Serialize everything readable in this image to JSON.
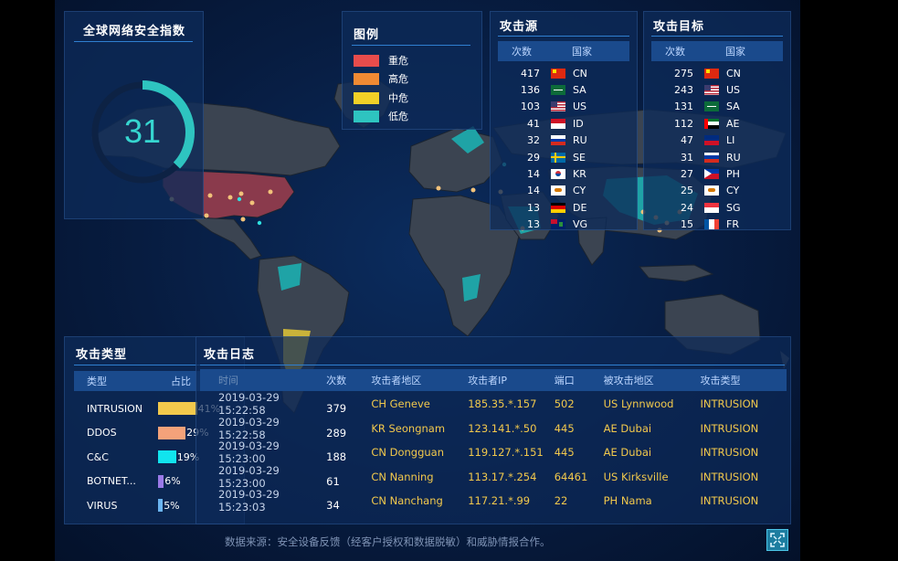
{
  "index_panel": {
    "title": "全球网络安全指数",
    "value": "31",
    "level": 0.31
  },
  "legend": {
    "title": "图例",
    "items": [
      {
        "label": "重危",
        "color": "#e84c4c"
      },
      {
        "label": "高危",
        "color": "#f08a33"
      },
      {
        "label": "中危",
        "color": "#f2d027"
      },
      {
        "label": "低危",
        "color": "#2ec4c0"
      }
    ]
  },
  "attack_source": {
    "title": "攻击源",
    "headers": {
      "count": "次数",
      "country": "国家"
    },
    "rows": [
      {
        "count": "417",
        "code": "CN",
        "flag": "cn-flag"
      },
      {
        "count": "136",
        "code": "SA",
        "flag": "sa-flag"
      },
      {
        "count": "103",
        "code": "US",
        "flag": "us-flag"
      },
      {
        "count": "41",
        "code": "ID",
        "flag": "id-flag"
      },
      {
        "count": "32",
        "code": "RU",
        "flag": "ru-flag"
      },
      {
        "count": "29",
        "code": "SE",
        "flag": "se-flag"
      },
      {
        "count": "14",
        "code": "KR",
        "flag": "kr-flag"
      },
      {
        "count": "14",
        "code": "CY",
        "flag": "cy-flag"
      },
      {
        "count": "13",
        "code": "DE",
        "flag": "de-flag"
      },
      {
        "count": "13",
        "code": "VG",
        "flag": "vg-flag"
      }
    ]
  },
  "attack_target": {
    "title": "攻击目标",
    "headers": {
      "count": "次数",
      "country": "国家"
    },
    "rows": [
      {
        "count": "275",
        "code": "CN",
        "flag": "cn-flag"
      },
      {
        "count": "243",
        "code": "US",
        "flag": "us-flag"
      },
      {
        "count": "131",
        "code": "SA",
        "flag": "sa-flag"
      },
      {
        "count": "112",
        "code": "AE",
        "flag": "ae-flag"
      },
      {
        "count": "47",
        "code": "LI",
        "flag": "li-flag"
      },
      {
        "count": "31",
        "code": "RU",
        "flag": "ru-flag"
      },
      {
        "count": "27",
        "code": "PH",
        "flag": "ph-flag"
      },
      {
        "count": "25",
        "code": "CY",
        "flag": "cy-flag"
      },
      {
        "count": "24",
        "code": "SG",
        "flag": "sg-flag"
      },
      {
        "count": "15",
        "code": "FR",
        "flag": "fr-flag"
      }
    ]
  },
  "attack_types": {
    "title": "攻击类型",
    "headers": {
      "type": "类型",
      "share": "占比"
    },
    "rows": [
      {
        "name": "INTRUSION",
        "pct": "41%",
        "share": 0.41,
        "color": "#f2c94c"
      },
      {
        "name": "DDOS",
        "pct": "29%",
        "share": 0.29,
        "color": "#f4a27a"
      },
      {
        "name": "C&C",
        "pct": "19%",
        "share": 0.19,
        "color": "#11e4ee"
      },
      {
        "name": "BOTNET...",
        "pct": "6%",
        "share": 0.06,
        "color": "#9b7ae8"
      },
      {
        "name": "VIRUS",
        "pct": "5%",
        "share": 0.05,
        "color": "#6bb4f0"
      }
    ]
  },
  "attack_log": {
    "title": "攻击日志",
    "headers": {
      "time": "时间",
      "count": "次数",
      "src": "攻击者地区",
      "ip": "攻击者IP",
      "port": "端口",
      "dst": "被攻击地区",
      "type": "攻击类型"
    },
    "rows": [
      {
        "time": "2019-03-29 15:22:58",
        "count": "379",
        "src": "CH Geneve",
        "ip": "185.35.*.157",
        "port": "502",
        "dst": "US Lynnwood",
        "type": "INTRUSION"
      },
      {
        "time": "2019-03-29 15:22:58",
        "count": "289",
        "src": "KR Seongnam",
        "ip": "123.141.*.50",
        "port": "445",
        "dst": "AE Dubai",
        "type": "INTRUSION"
      },
      {
        "time": "2019-03-29 15:23:00",
        "count": "188",
        "src": "CN Dongguan",
        "ip": "119.127.*.151",
        "port": "445",
        "dst": "AE Dubai",
        "type": "INTRUSION"
      },
      {
        "time": "2019-03-29 15:23:00",
        "count": "61",
        "src": "CN Nanning",
        "ip": "113.17.*.254",
        "port": "64461",
        "dst": "US Kirksville",
        "type": "INTRUSION"
      },
      {
        "time": "2019-03-29 15:23:03",
        "count": "34",
        "src": "CN Nanchang",
        "ip": "117.21.*.99",
        "port": "22",
        "dst": "PH Nama",
        "type": "INTRUSION"
      }
    ]
  },
  "footer": {
    "text": "数据来源：安全设备反馈（经客户授权和数据脱敏）和威胁情报合作。"
  },
  "colors": {
    "map_land": "#3b4451",
    "map_border": "#1b2430",
    "accent": "#2ec4c0",
    "critical": "#8a3a4c"
  }
}
